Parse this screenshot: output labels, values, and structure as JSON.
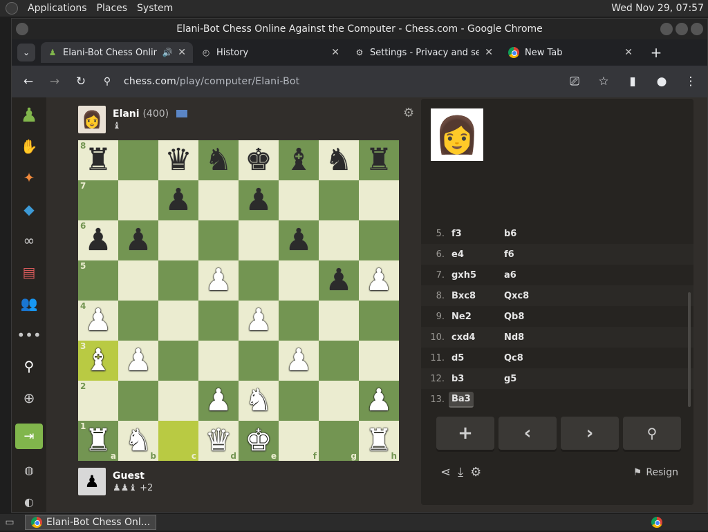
{
  "os": {
    "menu": [
      "Applications",
      "Places",
      "System"
    ],
    "clock": "Wed Nov 29, 07:57"
  },
  "window": {
    "title": "Elani-Bot Chess Online Against the Computer - Chess.com - Google Chrome"
  },
  "tabs": [
    {
      "label": "Elani-Bot Chess Online",
      "icon": "pawn-icon",
      "audio": true
    },
    {
      "label": "History",
      "icon": "history-icon"
    },
    {
      "label": "Settings - Privacy and security",
      "icon": "gear-icon"
    },
    {
      "label": "New Tab",
      "icon": "chrome-icon"
    }
  ],
  "toolbar": {
    "url_host": "chess.com",
    "url_path": "/play/computer/Elani-Bot"
  },
  "top_player": {
    "name": "Elani",
    "rating": "(400)"
  },
  "bottom_player": {
    "name": "Guest",
    "captured_extra": "+2"
  },
  "board": {
    "ranks": [
      "8",
      "7",
      "6",
      "5",
      "4",
      "3",
      "2",
      "1"
    ],
    "files": [
      "a",
      "b",
      "c",
      "d",
      "e",
      "f",
      "g",
      "h"
    ],
    "position": [
      [
        "bR",
        "",
        "bQ",
        "bN",
        "bK",
        "bB",
        "bN",
        "bR"
      ],
      [
        "",
        "",
        "bP",
        "",
        "bP",
        "",
        "",
        ""
      ],
      [
        "bP",
        "bP",
        "",
        "",
        "",
        "bP",
        "",
        ""
      ],
      [
        "",
        "",
        "",
        "wP",
        "",
        "",
        "bP",
        "wP"
      ],
      [
        "wP",
        "",
        "",
        "",
        "wP",
        "",
        "",
        ""
      ],
      [
        "wB",
        "wP",
        "",
        "",
        "",
        "wP",
        "",
        ""
      ],
      [
        "",
        "",
        "",
        "wP",
        "wN",
        "",
        "",
        "wP"
      ],
      [
        "wR",
        "wN",
        "",
        "wQ",
        "wK",
        "",
        "",
        "wR"
      ]
    ],
    "highlights": [
      "a3",
      "c1"
    ]
  },
  "moves": [
    {
      "n": "5.",
      "w": "f3",
      "b": "b6"
    },
    {
      "n": "6.",
      "w": "e4",
      "b": "f6"
    },
    {
      "n": "7.",
      "w": "gxh5",
      "b": "a6"
    },
    {
      "n": "8.",
      "w": "Bxc8",
      "b": "Qxc8"
    },
    {
      "n": "9.",
      "w": "Ne2",
      "b": "Qb8"
    },
    {
      "n": "10.",
      "w": "cxd4",
      "b": "Nd8"
    },
    {
      "n": "11.",
      "w": "d5",
      "b": "Qc8"
    },
    {
      "n": "12.",
      "w": "b3",
      "b": "g5"
    },
    {
      "n": "13.",
      "w": "Ba3",
      "b": ""
    }
  ],
  "panel": {
    "resign_label": "Resign"
  },
  "taskbar": {
    "window_label": "Elani-Bot Chess Onl..."
  }
}
